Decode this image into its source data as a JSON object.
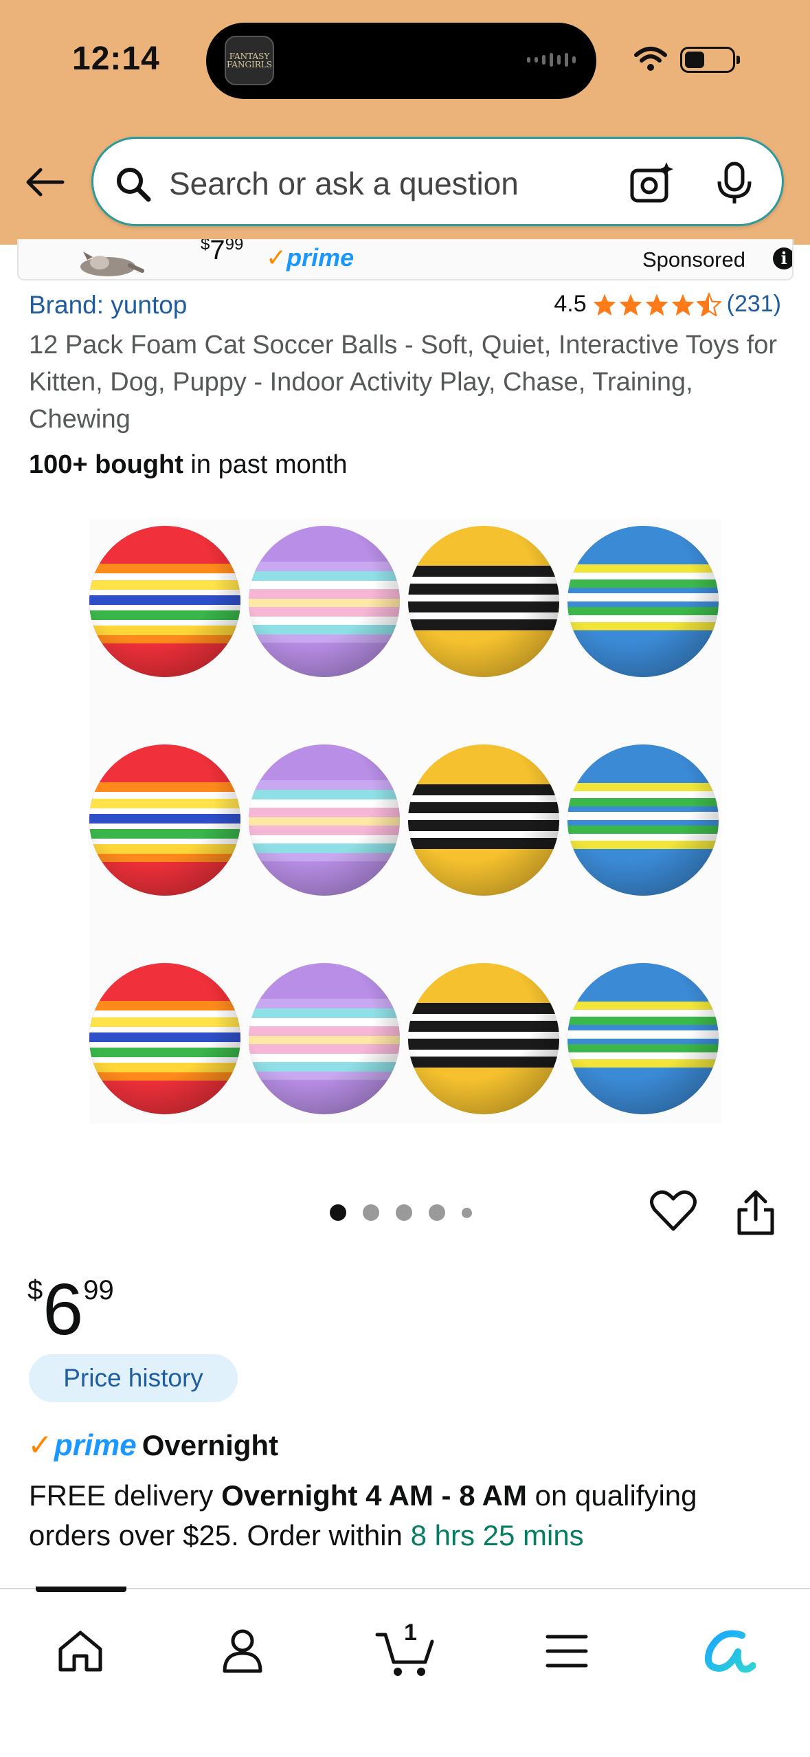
{
  "status_bar": {
    "time": "12:14",
    "island_app_label": "FANTASY FANGIRLS"
  },
  "header": {
    "search_placeholder": "Search or ask a question"
  },
  "sponsored": {
    "price_symbol": "$",
    "price_whole": "7",
    "price_fraction": "99",
    "prime_label": "prime",
    "label": "Sponsored"
  },
  "product": {
    "brand": "Brand: yuntop",
    "rating": "4.5",
    "rating_count": "(231)",
    "title": "12 Pack Foam Cat Soccer Balls - Soft, Quiet, Interactive Toys for Kitten, Dog, Puppy - Indoor Activity Play, Chase, Training, Chewing",
    "bought_bold": "100+ bought",
    "bought_rest": " in past month",
    "image_dots_total": 5,
    "image_dot_active": 1
  },
  "pricing": {
    "symbol": "$",
    "whole": "6",
    "fraction": "99",
    "price_history_label": "Price history"
  },
  "delivery": {
    "prime_word": "prime",
    "prime_tier": "Overnight",
    "line_prefix": "FREE delivery ",
    "line_bold": "Overnight 4 AM - 8 AM",
    "line_middle": " on qualifying orders over $25. Order within ",
    "countdown": "8 hrs 25 mins"
  },
  "bottom_nav": {
    "items": [
      "home-icon",
      "account-icon",
      "cart-icon",
      "menu-icon",
      "rufus-icon"
    ],
    "cart_count": "1"
  },
  "colors": {
    "header_bg": "#ebb27a",
    "link_blue": "#1f5da0",
    "prime_blue": "#1a98ff",
    "prime_orange": "#ff8800",
    "star_orange": "#ff7b1a",
    "green": "#067d62"
  }
}
